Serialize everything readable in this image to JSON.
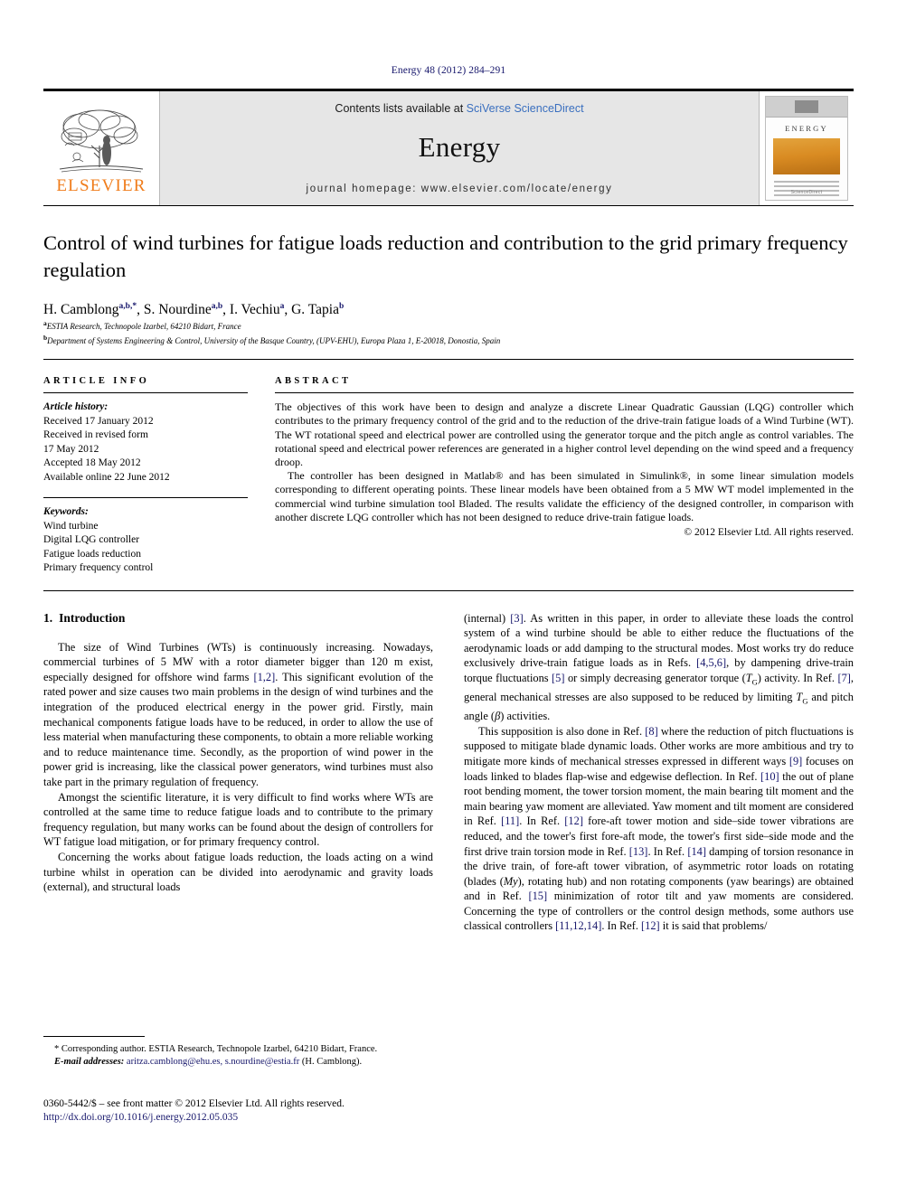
{
  "running_head": "Energy 48 (2012) 284–291",
  "masthead": {
    "publisher_logo_text": "ELSEVIER",
    "contents_prefix": "Contents lists available at ",
    "contents_link": "SciVerse ScienceDirect",
    "journal_name": "Energy",
    "homepage_line": "journal homepage: www.elsevier.com/locate/energy",
    "cover": {
      "title": "ENERGY",
      "footer": "ScienceDirect"
    }
  },
  "article": {
    "title": "Control of wind turbines for fatigue loads reduction and contribution to the grid primary frequency regulation",
    "authors": [
      {
        "name": "H. Camblong",
        "sup": "a,b,*"
      },
      {
        "name": "S. Nourdine",
        "sup": "a,b"
      },
      {
        "name": "I. Vechiu",
        "sup": "a"
      },
      {
        "name": "G. Tapia",
        "sup": "b"
      }
    ],
    "affiliations": [
      {
        "marker": "a",
        "text": "ESTIA Research, Technopole Izarbel, 64210 Bidart, France"
      },
      {
        "marker": "b",
        "text": "Department of Systems Engineering & Control, University of the Basque Country, (UPV-EHU), Europa Plaza 1, E-20018, Donostia, Spain"
      }
    ]
  },
  "article_info": {
    "heading": "ARTICLE INFO",
    "history_label": "Article history:",
    "history": [
      "Received 17 January 2012",
      "Received in revised form",
      "17 May 2012",
      "Accepted 18 May 2012",
      "Available online 22 June 2012"
    ],
    "keywords_label": "Keywords:",
    "keywords": [
      "Wind turbine",
      "Digital LQG controller",
      "Fatigue loads reduction",
      "Primary frequency control"
    ]
  },
  "abstract": {
    "heading": "ABSTRACT",
    "paragraphs": [
      "The objectives of this work have been to design and analyze a discrete Linear Quadratic Gaussian (LQG) controller which contributes to the primary frequency control of the grid and to the reduction of the drive-train fatigue loads of a Wind Turbine (WT). The WT rotational speed and electrical power are controlled using the generator torque and the pitch angle as control variables. The rotational speed and electrical power references are generated in a higher control level depending on the wind speed and a frequency droop.",
      "The controller has been designed in Matlab® and has been simulated in Simulink®, in some linear simulation models corresponding to different operating points. These linear models have been obtained from a 5 MW WT model implemented in the commercial wind turbine simulation tool Bladed. The results validate the efficiency of the designed controller, in comparison with another discrete LQG controller which has not been designed to reduce drive-train fatigue loads."
    ],
    "copyright": "© 2012 Elsevier Ltd. All rights reserved."
  },
  "body": {
    "section_number": "1.",
    "section_title": "Introduction",
    "left_paragraphs": [
      "The size of Wind Turbines (WTs) is continuously increasing. Nowadays, commercial turbines of 5 MW with a rotor diameter bigger than 120 m exist, especially designed for offshore wind farms [1,2]. This significant evolution of the rated power and size causes two main problems in the design of wind turbines and the integration of the produced electrical energy in the power grid. Firstly, main mechanical components fatigue loads have to be reduced, in order to allow the use of less material when manufacturing these components, to obtain a more reliable working and to reduce maintenance time. Secondly, as the proportion of wind power in the power grid is increasing, like the classical power generators, wind turbines must also take part in the primary regulation of frequency.",
      "Amongst the scientific literature, it is very difficult to find works where WTs are controlled at the same time to reduce fatigue loads and to contribute to the primary frequency regulation, but many works can be found about the design of controllers for WT fatigue load mitigation, or for primary frequency control.",
      "Concerning the works about fatigue loads reduction, the loads acting on a wind turbine whilst in operation can be divided into aerodynamic and gravity loads (external), and structural loads"
    ],
    "right_paragraphs": [
      "(internal) [3]. As written in this paper, in order to alleviate these loads the control system of a wind turbine should be able to either reduce the fluctuations of the aerodynamic loads or add damping to the structural modes. Most works try do reduce exclusively drive-train fatigue loads as in Refs. [4,5,6], by dampening drive-train torque fluctuations [5] or simply decreasing generator torque (TG) activity. In Ref. [7], general mechanical stresses are also supposed to be reduced by limiting TG and pitch angle (β) activities.",
      "This supposition is also done in Ref. [8] where the reduction of pitch fluctuations is supposed to mitigate blade dynamic loads. Other works are more ambitious and try to mitigate more kinds of mechanical stresses expressed in different ways [9] focuses on loads linked to blades flap-wise and edgewise deflection. In Ref. [10] the out of plane root bending moment, the tower torsion moment, the main bearing tilt moment and the main bearing yaw moment are alleviated. Yaw moment and tilt moment are considered in Ref. [11]. In Ref. [12] fore-aft tower motion and side–side tower vibrations are reduced, and the tower's first fore-aft mode, the tower's first side–side mode and the first drive train torsion mode in Ref. [13]. In Ref. [14] damping of torsion resonance in the drive train, of fore-aft tower vibration, of asymmetric rotor loads on rotating (blades (My), rotating hub) and non rotating components (yaw bearings) are obtained and in Ref. [15] minimization of rotor tilt and yaw moments are considered. Concerning the type of controllers or the control design methods, some authors use classical controllers [11,12,14]. In Ref. [12] it is said that problems/"
    ]
  },
  "footnote": {
    "corresponding": "* Corresponding author. ESTIA Research, Technopole Izarbel, 64210 Bidart, France.",
    "email_label": "E-mail addresses:",
    "emails": "aritza.camblong@ehu.es, s.nourdine@estia.fr",
    "email_suffix": "(H. Camblong)."
  },
  "page_footer": {
    "issn_line": "0360-5442/$ – see front matter © 2012 Elsevier Ltd. All rights reserved.",
    "doi": "http://dx.doi.org/10.1016/j.energy.2012.05.035"
  },
  "colors": {
    "link_blue": "#16166b",
    "sciencedirect_blue": "#3a6fbf",
    "elsevier_orange": "#f07c1a",
    "masthead_gray": "#e6e6e6"
  }
}
